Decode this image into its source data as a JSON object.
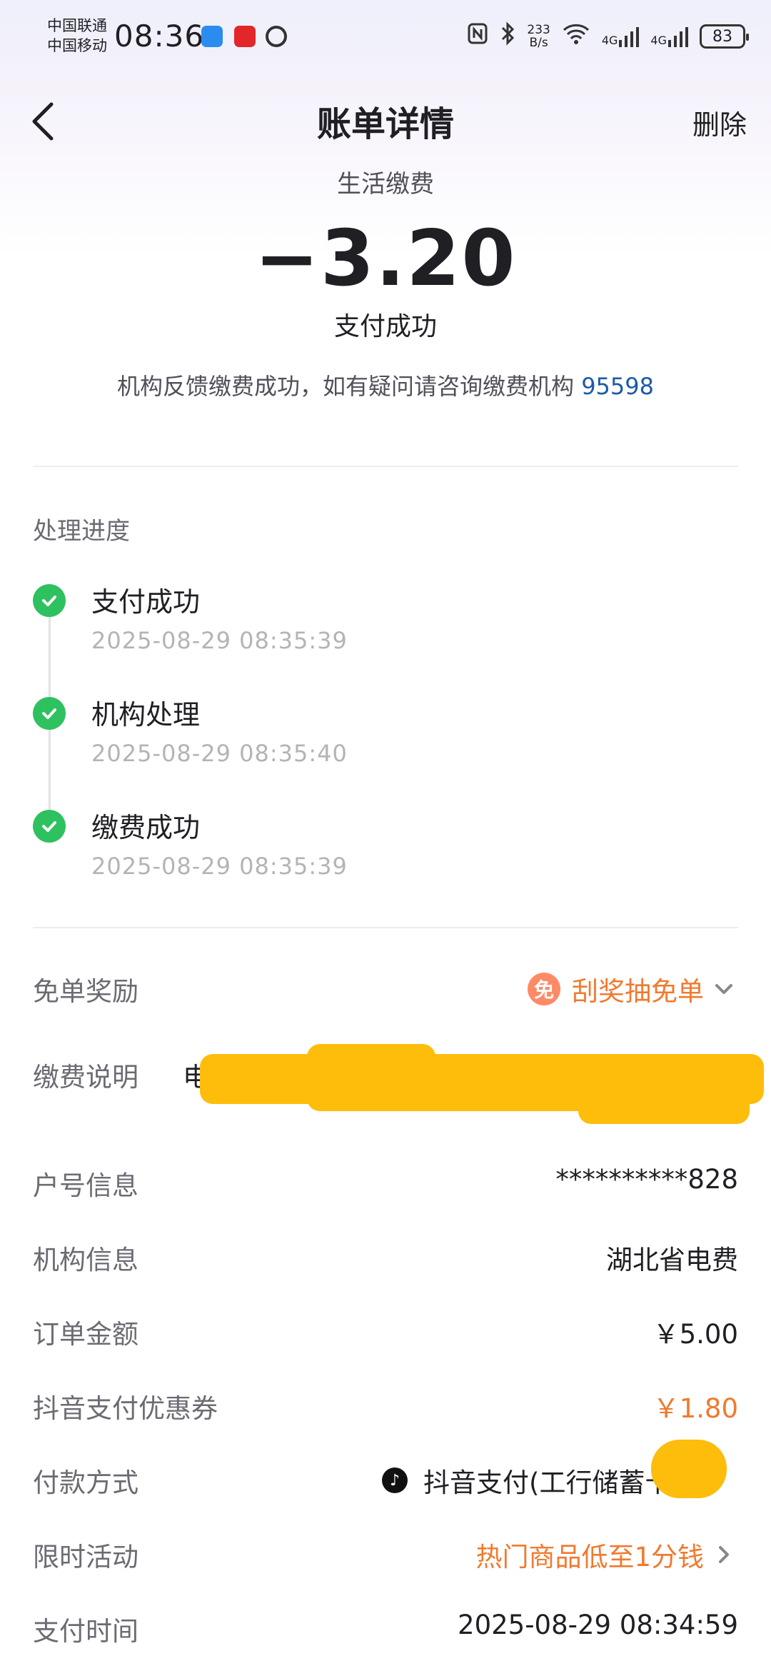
{
  "status_bar": {
    "carrier_1": "中国联通",
    "carrier_2": "中国移动",
    "time": "08:36",
    "net_speed_value": "233",
    "net_speed_unit": "B/s",
    "signal_1": "4G",
    "signal_2": "4G",
    "battery": "83"
  },
  "header": {
    "title": "账单详情",
    "delete_label": "删除"
  },
  "summary": {
    "category": "生活缴费",
    "amount": "−3.20",
    "status": "支付成功",
    "notice_text": "机构反馈缴费成功，如有疑问请咨询缴费机构",
    "notice_phone": "95598"
  },
  "progress": {
    "title": "处理进度",
    "steps": [
      {
        "label": "支付成功",
        "time": "2025-08-29 08:35:39"
      },
      {
        "label": "机构处理",
        "time": "2025-08-29 08:35:40"
      },
      {
        "label": "缴费成功",
        "time": "2025-08-29 08:35:39"
      }
    ]
  },
  "details": {
    "reward": {
      "label": "免单奖励",
      "badge": "免",
      "value": "刮奖抽免单"
    },
    "description": {
      "label": "缴费说明",
      "value": "电"
    },
    "account": {
      "label": "户号信息",
      "value": "**********828"
    },
    "institution": {
      "label": "机构信息",
      "value": "湖北省电费"
    },
    "order_amount": {
      "label": "订单金额",
      "value": "￥5.00"
    },
    "coupon": {
      "label": "抖音支付优惠券",
      "value": "￥1.80"
    },
    "payment_method": {
      "label": "付款方式",
      "value": "抖音支付(工行储蓄卡7"
    },
    "promotion": {
      "label": "限时活动",
      "value": "热门商品低至1分钱"
    },
    "pay_time": {
      "label": "支付时间",
      "value": "2025-08-29 08:34:59"
    }
  },
  "colors": {
    "success_green": "#2ec15f",
    "accent_orange": "#f07a2e",
    "link_blue": "#1e5aa8",
    "redaction_yellow": "#fdbd0a"
  }
}
